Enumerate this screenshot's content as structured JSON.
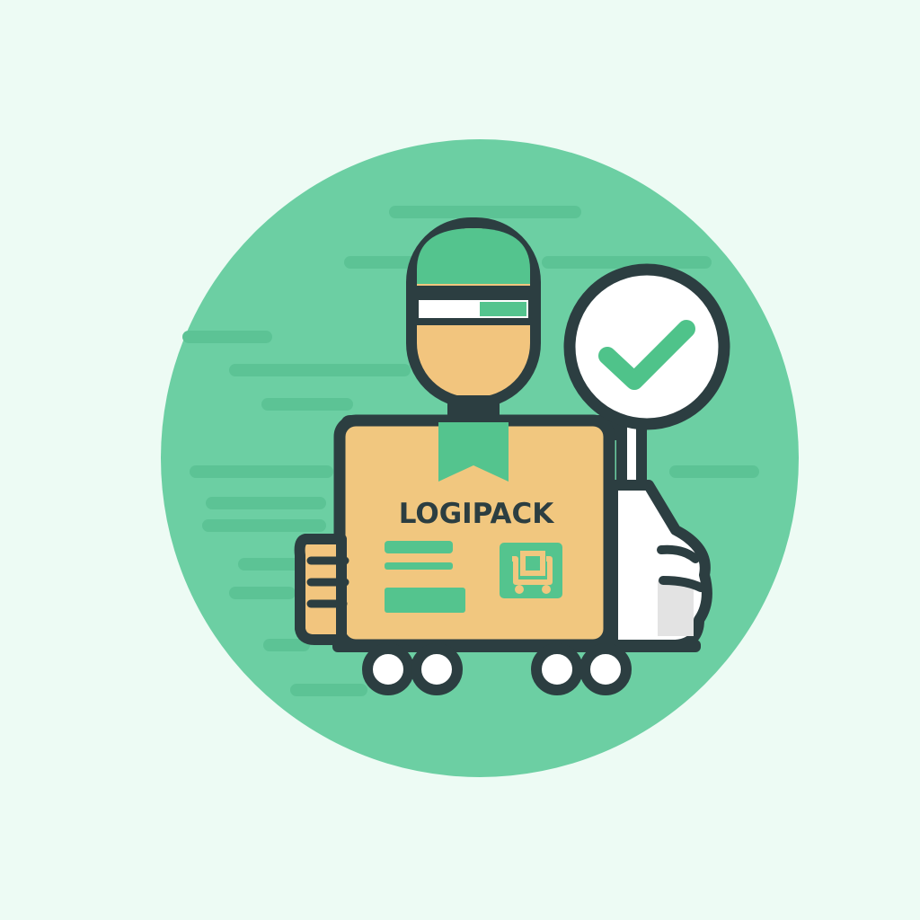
{
  "illustration": {
    "brand_name": "LOGIPACK",
    "icons": {
      "courier": "delivery-person-icon",
      "package": "package-box-icon",
      "badge": "checkmark-badge-icon",
      "label_symbol": "cart-icon"
    },
    "colors": {
      "background": "#edfbf4",
      "circle": "#6ccfa3",
      "speed_lines": "#5cc395",
      "cap": "#54c48e",
      "skin": "#f2c57e",
      "box": "#f1c77f",
      "outline": "#2c3e41",
      "white": "#ffffff",
      "check": "#4fc38a",
      "shadow_gray": "#e3e3e3"
    }
  }
}
